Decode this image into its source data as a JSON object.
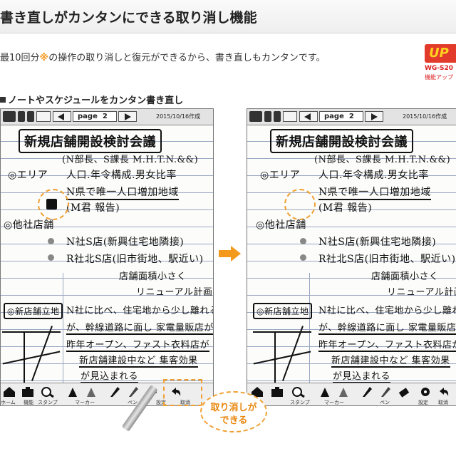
{
  "header": {
    "title": "書き直しがカンタンにできる取り消し機能"
  },
  "description": {
    "prefix": "最10回分",
    "mark": "※",
    "suffix": "の操作の取り消しと復元ができるから、書き直しもカンタンです。"
  },
  "badge": {
    "label": "UP",
    "model": "WG-S20",
    "note": "機能アップ"
  },
  "section": {
    "label": "ノートやスケジュールをカンタン書き直し"
  },
  "device": {
    "page_label": "page",
    "page_number": "2",
    "date": "2015/10/16作成",
    "note": {
      "title": "新規店舗開設検討会議",
      "attendees": "(N部長、S課長 M.H.T.N.&&)",
      "area_label": "◎エリア",
      "area_note": "人口.年令構成.男女比率",
      "growth": "N県で唯一人口増加地域",
      "report": "(M君 報告)",
      "competitor_label": "◎他社店舗",
      "store_n": "N社S店(新興住宅地隣接)",
      "store_r": "R社北S店(旧市街地、駅近い)",
      "store_size": "店舗面積小さく",
      "renewal": "リニューアル計画中!",
      "candidate_label": "◎新店舗立地",
      "line1": "N社に比べ、住宅地から少し離れる",
      "line2": "が、幹線道路に面し 家電量販店が",
      "line3": "昨年オープン、ファスト衣料店が",
      "line4": "新店舗建設中など 集客効果",
      "line5": "が見込まれる"
    },
    "toolbar_labels": {
      "home": "ホーム",
      "function": "機能",
      "stamp": "スタンプ",
      "marker": "マーカー",
      "pen": "ペン",
      "settings": "設定",
      "undo": "取消"
    }
  },
  "callout": {
    "line1": "取り消しが",
    "line2": "できる"
  },
  "colors": {
    "accent": "#f39a1d",
    "dashed": "#f0a033",
    "badge_red": "#e23b2b"
  }
}
